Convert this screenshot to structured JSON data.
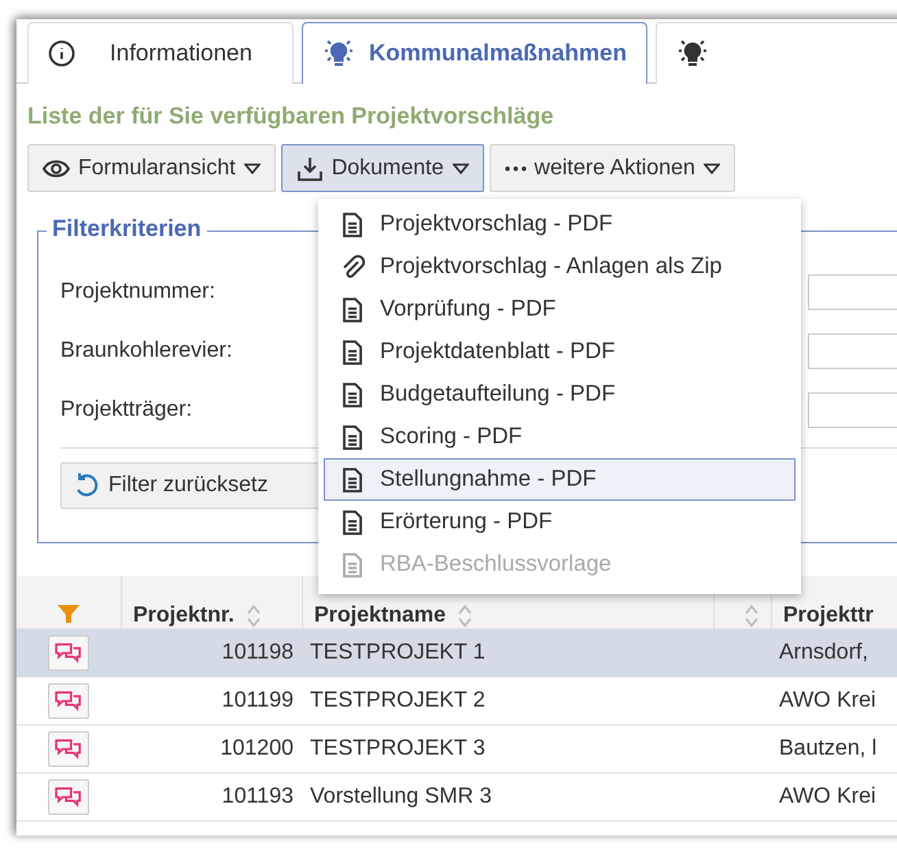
{
  "tabs": [
    {
      "label": "Informationen",
      "selected": false
    },
    {
      "label": "Kommunalmaßnahmen",
      "selected": true
    },
    {
      "selected": false
    }
  ],
  "heading": "Liste der für Sie verfügbaren Projektvorschläge",
  "toolbar": [
    {
      "label": "Formularansicht",
      "selected": false
    },
    {
      "label": "Dokumente",
      "selected": true
    },
    {
      "label": "weitere Aktionen",
      "selected": false
    }
  ],
  "filter": {
    "title": "Filterkriterien",
    "fields": [
      "Projektnummer:",
      "Braunkohlerevier:",
      "Projektträger:"
    ],
    "reset_button": "Filter zurücksetz"
  },
  "menu": [
    {
      "label": "Projektvorschlag - PDF",
      "kind": "pdf",
      "selected": false,
      "disabled": false
    },
    {
      "label": "Projektvorschlag - Anlagen als Zip",
      "kind": "zip",
      "selected": false,
      "disabled": false
    },
    {
      "label": "Vorprüfung - PDF",
      "kind": "pdf",
      "selected": false,
      "disabled": false
    },
    {
      "label": "Projektdatenblatt - PDF",
      "kind": "pdf",
      "selected": false,
      "disabled": false
    },
    {
      "label": "Budgetaufteilung - PDF",
      "kind": "pdf",
      "selected": false,
      "disabled": false
    },
    {
      "label": "Scoring - PDF",
      "kind": "pdf",
      "selected": false,
      "disabled": false
    },
    {
      "label": "Stellungnahme - PDF",
      "kind": "pdf",
      "selected": true,
      "disabled": false
    },
    {
      "label": "Erörterung - PDF",
      "kind": "pdf",
      "selected": false,
      "disabled": false
    },
    {
      "label": "RBA-Beschlussvorlage",
      "kind": "pdf",
      "selected": false,
      "disabled": true
    }
  ],
  "table": {
    "columns": [
      "Projektnr.",
      "Projektname",
      "",
      "Projekttr"
    ],
    "rows": [
      {
        "number": "101198",
        "name": "TESTPROJEKT 1",
        "carrier": "Arnsdorf,",
        "selected": true
      },
      {
        "number": "101199",
        "name": "TESTPROJEKT 2",
        "carrier": "AWO Krei",
        "selected": false
      },
      {
        "number": "101200",
        "name": "TESTPROJEKT 3",
        "carrier": "Bautzen, l",
        "selected": false
      },
      {
        "number": "101193",
        "name": "Vorstellung SMR 3",
        "carrier": "AWO Krei",
        "selected": false
      }
    ]
  }
}
